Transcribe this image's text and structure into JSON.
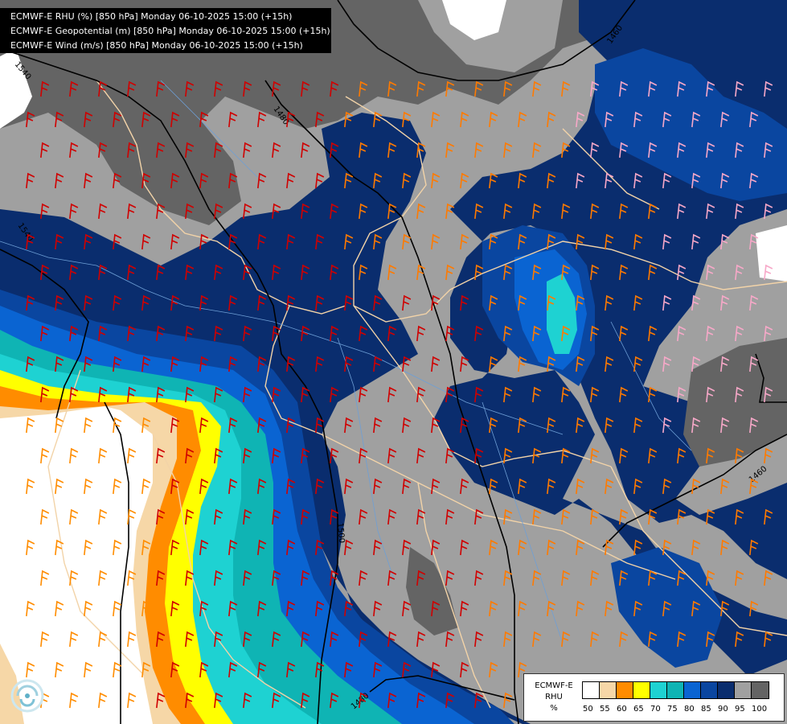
{
  "title_lines": [
    "ECMWF-E RHU (%) [850 hPa] Monday 06-10-2025 15:00 (+15h)",
    "ECMWF-E Geopotential (m) [850 hPa] Monday 06-10-2025 15:00 (+15h)",
    "ECMWF-E Wind (m/s) [850 hPa] Monday 06-10-2025 15:00 (+15h)"
  ],
  "legend": {
    "label_lines": [
      "ECMWF-E",
      "RHU",
      "%"
    ],
    "classes": [
      {
        "value": "50",
        "color": "#ffffff"
      },
      {
        "value": "55",
        "color": "#f6d7a7"
      },
      {
        "value": "60",
        "color": "#ff8c00"
      },
      {
        "value": "65",
        "color": "#ffff00"
      },
      {
        "value": "70",
        "color": "#1ed2d2"
      },
      {
        "value": "75",
        "color": "#0fb4b4"
      },
      {
        "value": "80",
        "color": "#0a64d2"
      },
      {
        "value": "85",
        "color": "#0a46a0"
      },
      {
        "value": "90",
        "color": "#0a2d6e"
      },
      {
        "value": "95",
        "color": "#a0a0a0"
      },
      {
        "value": "100",
        "color": "#646464"
      }
    ]
  },
  "contour_labels": [
    "1540",
    "1480",
    "1460",
    "1540",
    "1500",
    "1460",
    "1480"
  ],
  "logo_icon": "ecmwf-logo-icon"
}
